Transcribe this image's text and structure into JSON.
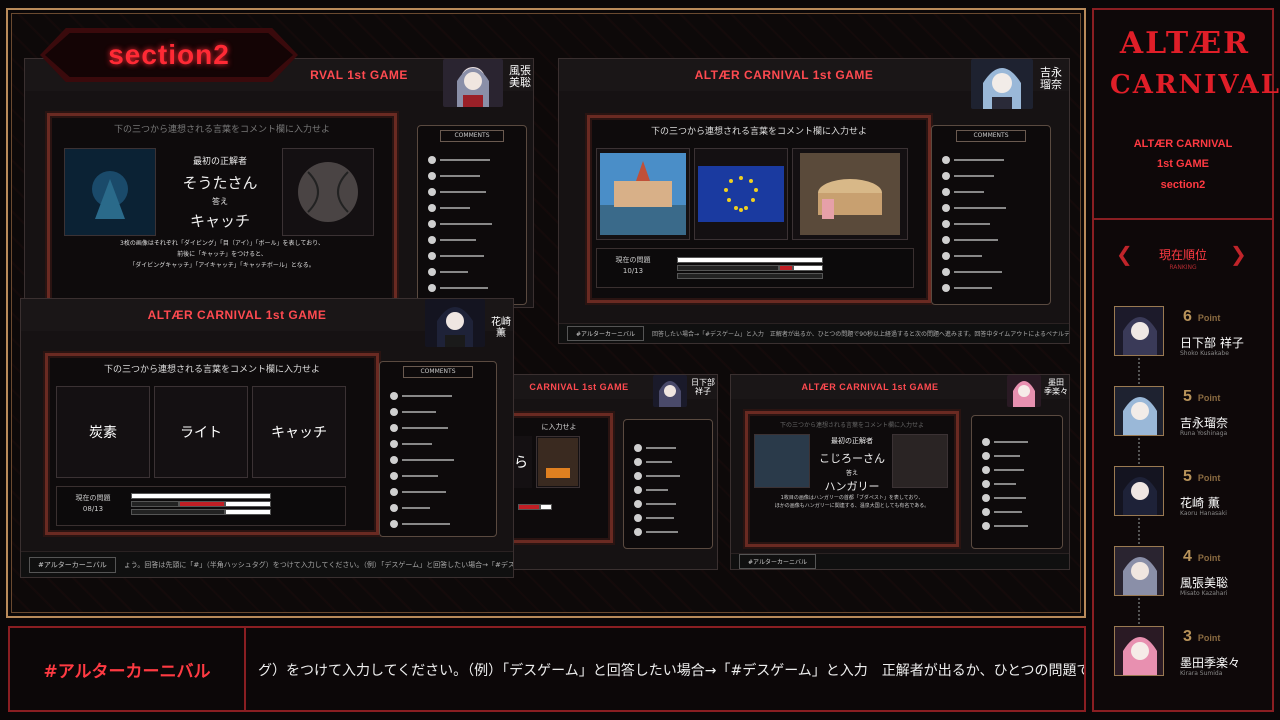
{
  "section_badge": "section2",
  "right_panel": {
    "logo_line1": "ALTÆR",
    "logo_line2": "CARNIVAL",
    "title_lines": [
      "ALTÆR CARNIVAL",
      "1st GAME",
      "section2"
    ],
    "ranking_title": "現在順位",
    "ranking_sub": "RANKING",
    "ranking": [
      {
        "points": "6",
        "unit": "Point",
        "name": "日下部 祥子",
        "romaji": "Shoko Kusakabe"
      },
      {
        "points": "5",
        "unit": "Point",
        "name": "吉永瑠奈",
        "romaji": "Runa Yoshinaga"
      },
      {
        "points": "5",
        "unit": "Point",
        "name": "花崎 薫",
        "romaji": "Kaoru Hanasaki"
      },
      {
        "points": "4",
        "unit": "Point",
        "name": "風張美聡",
        "romaji": "Misato Kazahari"
      },
      {
        "points": "3",
        "unit": "Point",
        "name": "墨田季楽々",
        "romaji": "Kirara Sumida"
      }
    ]
  },
  "bottom_bar": {
    "hashtag": "#アルターカーニバル",
    "ticker": "グ）をつけて入力してください。（例）「デスゲーム」と回答したい場合→「#デスゲーム」と入力　正解者が出るか、ひとつの問題で90秒以"
  },
  "windows": {
    "w1": {
      "title": "RVAL 1st GAME",
      "player": "風張\n美聡",
      "player_romaji": "Misato Kazahari",
      "question": "下の三つから連想される言葉をコメント欄に入力せよ",
      "solver_label": "最初の正解者",
      "solver": "そうたさん",
      "answer_label": "答え",
      "answer": "キャッチ",
      "explain1": "3枚の画像はそれぞれ「ダイビング」「目（アイ）」「ボール」を表しており、",
      "explain2": "前後に「キャッチ」をつけると、",
      "explain3": "「ダイビングキャッチ」「アイキャッチ」「キャッチボール」となる。",
      "comments_title": "COMMENTS"
    },
    "w2": {
      "title": "ALTÆR CARNIVAL 1st GAME",
      "player": "吉永\n瑠奈",
      "player_romaji": "Runa Yoshinaga",
      "question": "下の三つから連想される言葉をコメント欄に入力せよ",
      "progress_label": "現在の問題",
      "progress_value": "10/13",
      "comments_title": "COMMENTS",
      "ticker_tag": "#アルターカーニバル",
      "ticker": "回答したい場合→「#デスゲーム」と入力　正解者が出るか、ひとつの問題で90秒以上経過すると次の問題へ進みます。回答中タイムアウトによるペナルティはありま"
    },
    "w3": {
      "title": "ALTÆR CARNIVAL 1st GAME",
      "player": "花崎薫",
      "player_romaji": "Kaoru Hanasaki",
      "question": "下の三つから連想される言葉をコメント欄に入力せよ",
      "card1": "炭素",
      "card2": "ライト",
      "card3": "キャッチ",
      "progress_label": "現在の問題",
      "progress_value": "08/13",
      "comments_title": "COMMENTS",
      "ticker_tag": "#アルターカーニバル",
      "ticker": "ょう。回答は先頭に「#」（半角ハッシュタグ）をつけて入力してください。（例）「デスゲーム」と回答したい場合→「#デスゲーム」と入力　正解者が出るか、ひ"
    },
    "w4": {
      "title": "CARNIVAL 1st GAME",
      "player": "日下部\n祥子",
      "question": "に入力せよ",
      "card1": "ら"
    },
    "w5": {
      "title": "ALTÆR CARNIVAL 1st GAME",
      "player": "墨田\n季楽々",
      "question": "下の三つから連想される言葉をコメント欄に入力せよ",
      "solver_label": "最初の正解者",
      "solver": "こじろーさん",
      "answer_label": "答え",
      "answer": "ハンガリー",
      "explain1": "1枚目の画像はハンガリーの首都「ブダペスト」を表しており、",
      "explain2": "ほかの画像もハンガリーに関連する、温泉大国としても有名である。",
      "ticker_tag": "#アルターカーニバル"
    }
  }
}
